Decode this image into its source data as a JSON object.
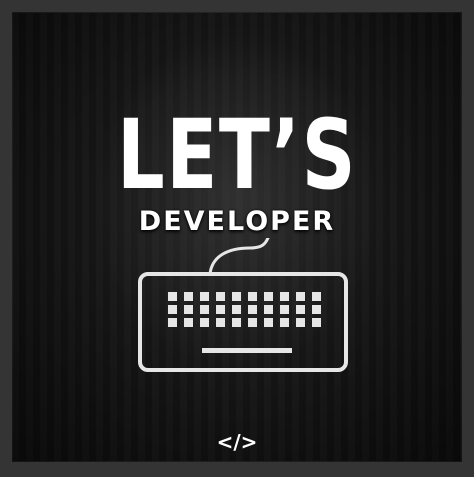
{
  "poster": {
    "headline": "LET’S",
    "subheadline": "DEVELOPER",
    "footer_symbol": "</>",
    "icon": "keyboard-icon",
    "colors": {
      "background": "#121212",
      "foreground": "#ffffff",
      "keyboard_stroke": "#e6e6e6"
    }
  }
}
